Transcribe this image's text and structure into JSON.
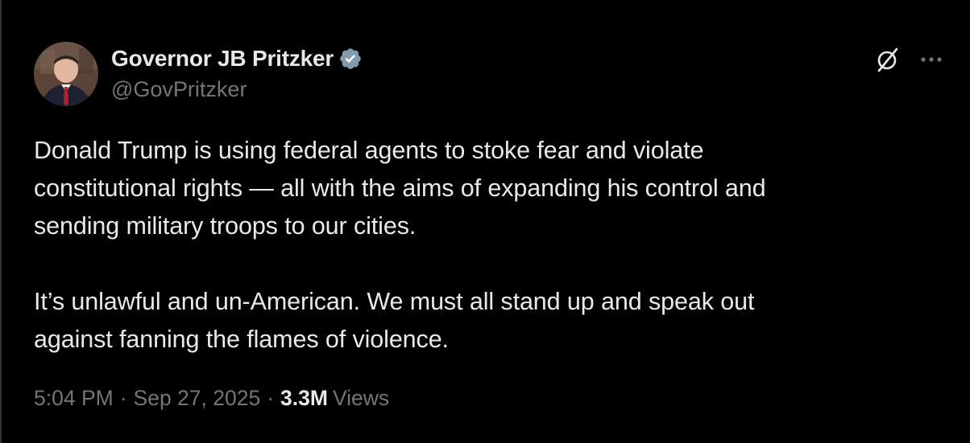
{
  "author": {
    "display_name": "Governor JB Pritzker",
    "handle": "@GovPritzker",
    "verified_icon": "verified-badge-icon",
    "avatar_icon": "avatar-photo"
  },
  "toolbar": {
    "grok_icon": "grok-slash-icon",
    "more_icon": "more-dots-icon"
  },
  "tweet": {
    "paragraphs": [
      {
        "lines": [
          "Donald Trump is using federal agents to stoke fear and violate",
          "constitutional rights — all with the aims of expanding his control and",
          "sending military troops to our cities."
        ]
      },
      {
        "lines": [
          "It’s unlawful and un-American. We must all stand up and speak out",
          "against fanning the flames of violence."
        ]
      }
    ]
  },
  "meta": {
    "time": "5:04 PM",
    "separator": "·",
    "date": "Sep 27, 2025",
    "views_count": "3.3M",
    "views_label": "Views"
  },
  "colors": {
    "background": "#000000",
    "primary_text": "#e7e9ea",
    "secondary_text": "#71767b",
    "verified_badge": "#829aab"
  }
}
